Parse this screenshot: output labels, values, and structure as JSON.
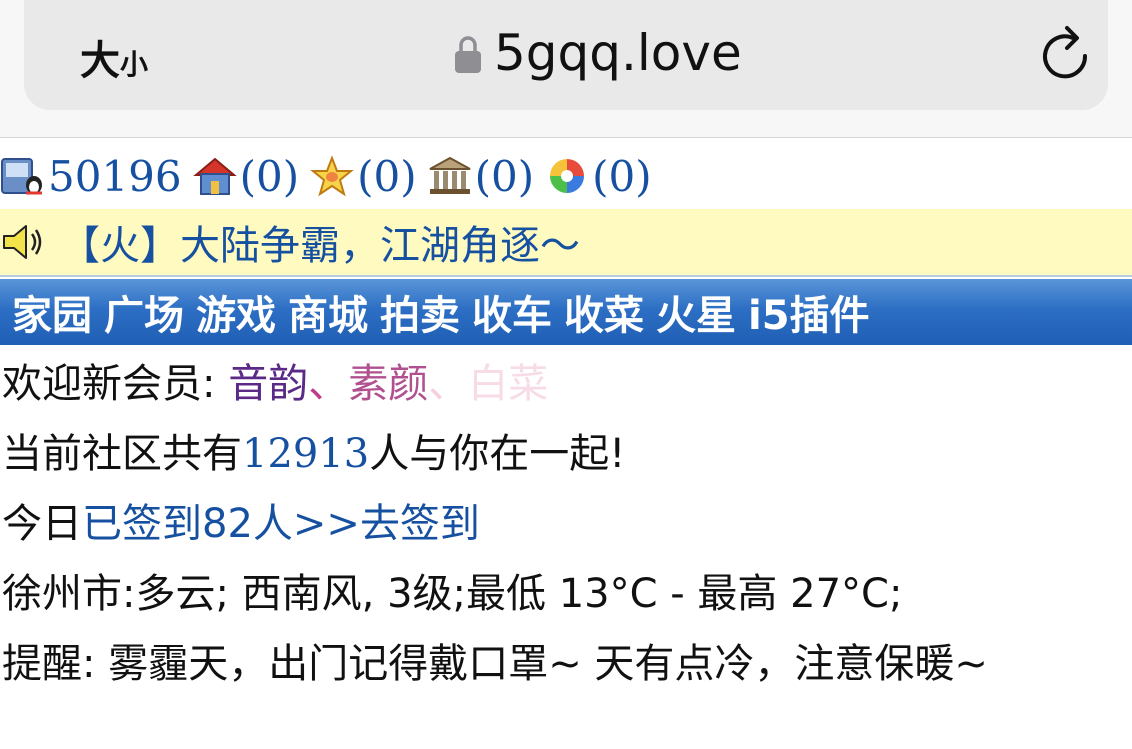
{
  "browser": {
    "text_size_big": "大",
    "text_size_small": "小",
    "domain": "5gqq.love"
  },
  "stats": [
    {
      "icon": "qq-user-icon",
      "value": "50196"
    },
    {
      "icon": "home-icon",
      "value": "(0)"
    },
    {
      "icon": "star-icon",
      "value": "(0)"
    },
    {
      "icon": "bank-icon",
      "value": "(0)"
    },
    {
      "icon": "pinwheel-icon",
      "value": "(0)"
    }
  ],
  "notice": {
    "icon": "speaker-icon",
    "text": "【火】大陆争霸，江湖角逐～"
  },
  "nav": [
    "家园",
    "广场",
    "游戏",
    "商城",
    "拍卖",
    "收车",
    "收菜",
    "火星",
    "i5插件"
  ],
  "welcome": {
    "label": "欢迎新会员: ",
    "members": [
      "音韵",
      "素颜",
      "白菜"
    ],
    "separator": "、"
  },
  "community": {
    "prefix": "当前社区共有",
    "count": "12913",
    "suffix": "人与你在一起!"
  },
  "signin": {
    "prefix": "今日",
    "signed": "已签到82人",
    "arrows": ">>",
    "action": "去签到"
  },
  "weather": {
    "text": "徐州市:多云; 西南风, 3级;最低 13°C - 最高 27°C;"
  },
  "reminder": {
    "text": "提醒: 雾霾天，出门记得戴口罩~ 天有点冷，注意保暖~"
  },
  "colors": {
    "link": "#1650a0",
    "notice_bg": "#fffbc0",
    "nav_bg": "#2d6fc4"
  }
}
